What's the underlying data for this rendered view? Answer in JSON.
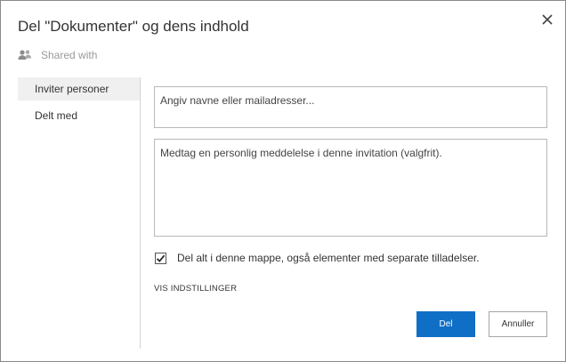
{
  "dialog": {
    "title": "Del \"Dokumenter\" og dens indhold",
    "shared_with": "Shared with"
  },
  "nav": {
    "items": [
      {
        "label": "Inviter personer",
        "selected": true
      },
      {
        "label": "Delt med",
        "selected": false
      }
    ]
  },
  "form": {
    "names_placeholder": "Angiv navne eller mailadresser...",
    "message_placeholder": "Medtag en personlig meddelelse i denne invitation (valgfrit).",
    "share_all_label": "Del alt i denne mappe, også elementer med separate tilladelser.",
    "share_all_checked": true,
    "show_options": "VIS INDSTILLINGER"
  },
  "buttons": {
    "share": "Del",
    "cancel": "Annuller"
  },
  "colors": {
    "primary": "#0f6fc6",
    "selected_nav": "#f0f0f0"
  },
  "icons": {
    "close": "close-icon",
    "people": "people-icon",
    "check": "checkmark-icon"
  }
}
